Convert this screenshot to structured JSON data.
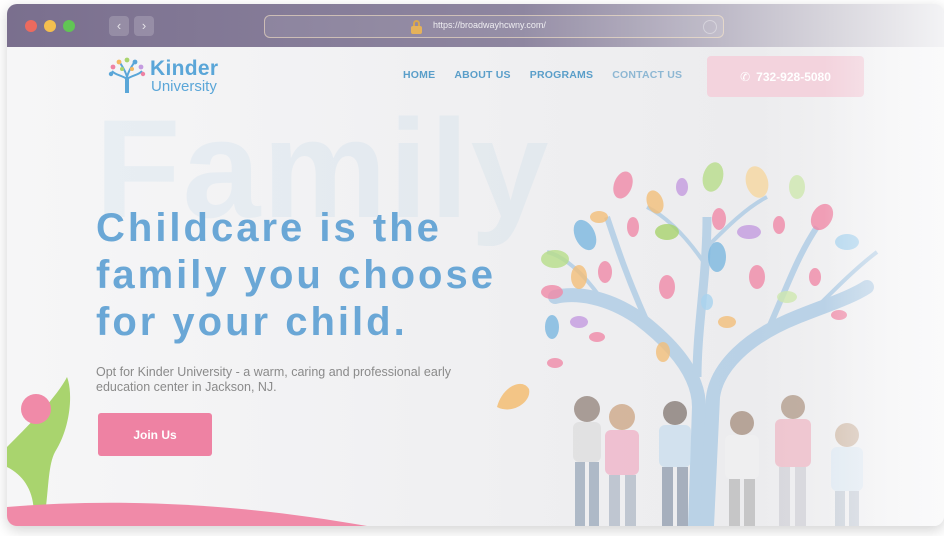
{
  "browser": {
    "url": "https://broadwayhcwny.com/",
    "back_icon": "chevron-left-icon",
    "forward_icon": "chevron-right-icon"
  },
  "site": {
    "logo": {
      "name": "Kinder",
      "subname": "University"
    },
    "nav": [
      {
        "label": "HOME"
      },
      {
        "label": "ABOUT US"
      },
      {
        "label": "PROGRAMS"
      },
      {
        "label": "CONTACT US"
      }
    ],
    "phone": {
      "icon": "phone-icon",
      "number": "732-928-5080"
    }
  },
  "hero": {
    "background_word": "Family",
    "headline": "Childcare is the family you choose for your child.",
    "subtext": "Opt for Kinder University - a warm, caring and professional early education center in Jackson, NJ.",
    "cta_label": "Join Us"
  },
  "colors": {
    "brand_blue": "#5aa6d8",
    "cta_pink": "#ee82a3",
    "leaf_green": "#a9d46e"
  }
}
